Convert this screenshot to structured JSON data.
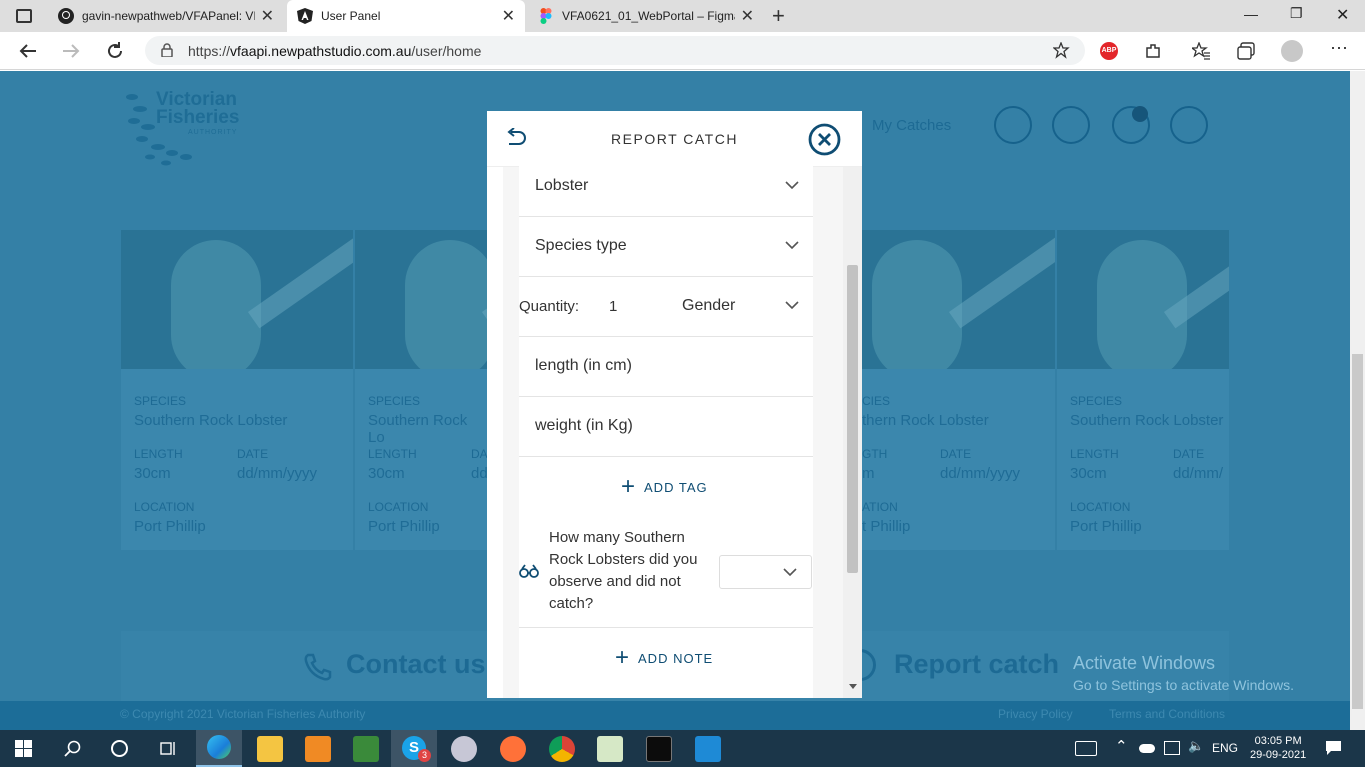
{
  "browser": {
    "tabs": [
      {
        "title": "gavin-newpathweb/VFAPanel: VF",
        "close": "✕"
      },
      {
        "title": "User Panel",
        "close": "✕"
      },
      {
        "title": "VFA0621_01_WebPortal – Figma",
        "close": "✕"
      }
    ],
    "new_tab": "+",
    "url_prefix": "https://",
    "url_host": "vfaapi.newpathstudio.com.au",
    "url_path": "/user/home",
    "window_controls": {
      "minimize": "—",
      "restore": "❐",
      "close": "✕"
    },
    "extensions": {
      "abp": "ABP"
    }
  },
  "site": {
    "logo": {
      "line1": "Victorian",
      "line2": "Fisheries",
      "line3": "AUTHORITY"
    },
    "nav_my_catches": "My Catches",
    "cards": [
      {
        "species_label": "SPECIES",
        "species": "Southern Rock Lobster",
        "length_label": "LENGTH",
        "length": "30cm",
        "date_label": "DATE",
        "date": "dd/mm/yyyy",
        "location_label": "LOCATION",
        "location": "Port Phillip"
      },
      {
        "species_label": "SPECIES",
        "species": "Southern Rock Lo",
        "length_label": "LENGTH",
        "length": "30cm",
        "date_label": "DA",
        "date": "dd",
        "location_label": "LOCATION",
        "location": "Port Phillip"
      },
      {
        "species_label": "CIES",
        "species": "thern Rock Lobster",
        "length_label": "GTH",
        "length": "m",
        "date_label": "DATE",
        "date": "dd/mm/yyyy",
        "location_label": "ATION",
        "location": "t Phillip"
      },
      {
        "species_label": "SPECIES",
        "species": "Southern Rock Lobster",
        "length_label": "LENGTH",
        "length": "30cm",
        "date_label": "DATE",
        "date": "dd/mm/",
        "location_label": "LOCATION",
        "location": "Port Phillip"
      }
    ],
    "contact_us": "Contact us",
    "report_catch": "Report catch",
    "footer": {
      "copyright": "© Copyright 2021 Victorian Fisheries Authority",
      "privacy": "Privacy Policy",
      "terms": "Terms and Conditions"
    },
    "activate_windows": {
      "line1": "Activate Windows",
      "line2": "Go to Settings to activate Windows."
    }
  },
  "modal": {
    "title": "REPORT CATCH",
    "species_select": "Lobster",
    "species_type_select": "Species type",
    "quantity_label": "Quantity:",
    "quantity_value": "1",
    "gender_select": "Gender",
    "length_placeholder": "length (in cm)",
    "weight_placeholder": "weight (in Kg)",
    "add_tag": "ADD TAG",
    "observed_question": "How many Southern Rock Lobsters did you observe and did not catch?",
    "add_note": "ADD NOTE"
  },
  "taskbar": {
    "language": "ENG",
    "time": "03:05 PM",
    "date": "29-09-2021",
    "skype_badge": "3"
  },
  "colors": {
    "page_bg": "#3480a6",
    "brand_dark": "#0f4d73",
    "taskbar": "#1b3649"
  }
}
